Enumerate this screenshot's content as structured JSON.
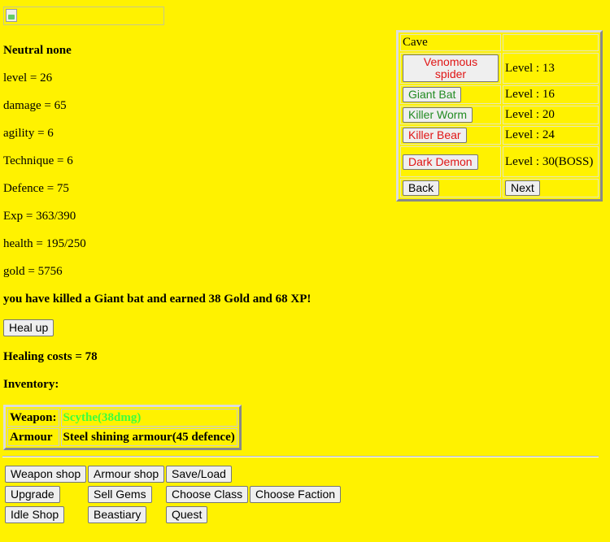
{
  "stats": {
    "faction": "Neutral none",
    "level": "level = 26",
    "damage": "damage = 65",
    "agility": "agility = 6",
    "technique": "Technique = 6",
    "defence": "Defence = 75",
    "exp": "Exp = 363/390",
    "health": "health = 195/250",
    "gold": "gold = 5756"
  },
  "message": "you have killed a Giant bat and earned 38 Gold and 68 XP!",
  "heal_button": "Heal up",
  "healing_costs": "Healing costs = 78",
  "inventory_label": "Inventory:",
  "inventory": {
    "weapon_label": "Weapon:",
    "weapon_value": "Scythe(38dmg)",
    "armour_label": "Armour",
    "armour_value": "Steel shining armour(45 defence)"
  },
  "nav": {
    "weapon_shop": "Weapon shop",
    "armour_shop": "Armour shop",
    "save_load": "Save/Load",
    "upgrade": "Upgrade",
    "sell_gems": "Sell Gems",
    "choose_class": "Choose Class",
    "choose_faction": "Choose Faction",
    "idle_shop": "Idle Shop",
    "beastiary": "Beastiary",
    "quest": "Quest"
  },
  "cave": {
    "title": "Cave",
    "monsters": [
      {
        "name": "Venomous spider",
        "level": "Level : 13",
        "color": "#e01515"
      },
      {
        "name": "Giant Bat",
        "level": "Level : 16",
        "color": "#228b22"
      },
      {
        "name": "Killer Worm",
        "level": "Level : 20",
        "color": "#228b22"
      },
      {
        "name": "Killer Bear",
        "level": "Level : 24",
        "color": "#e01515"
      },
      {
        "name": "Dark Demon",
        "level": "Level : 30(BOSS)",
        "color": "#e01515"
      }
    ],
    "back": "Back",
    "next": "Next"
  }
}
